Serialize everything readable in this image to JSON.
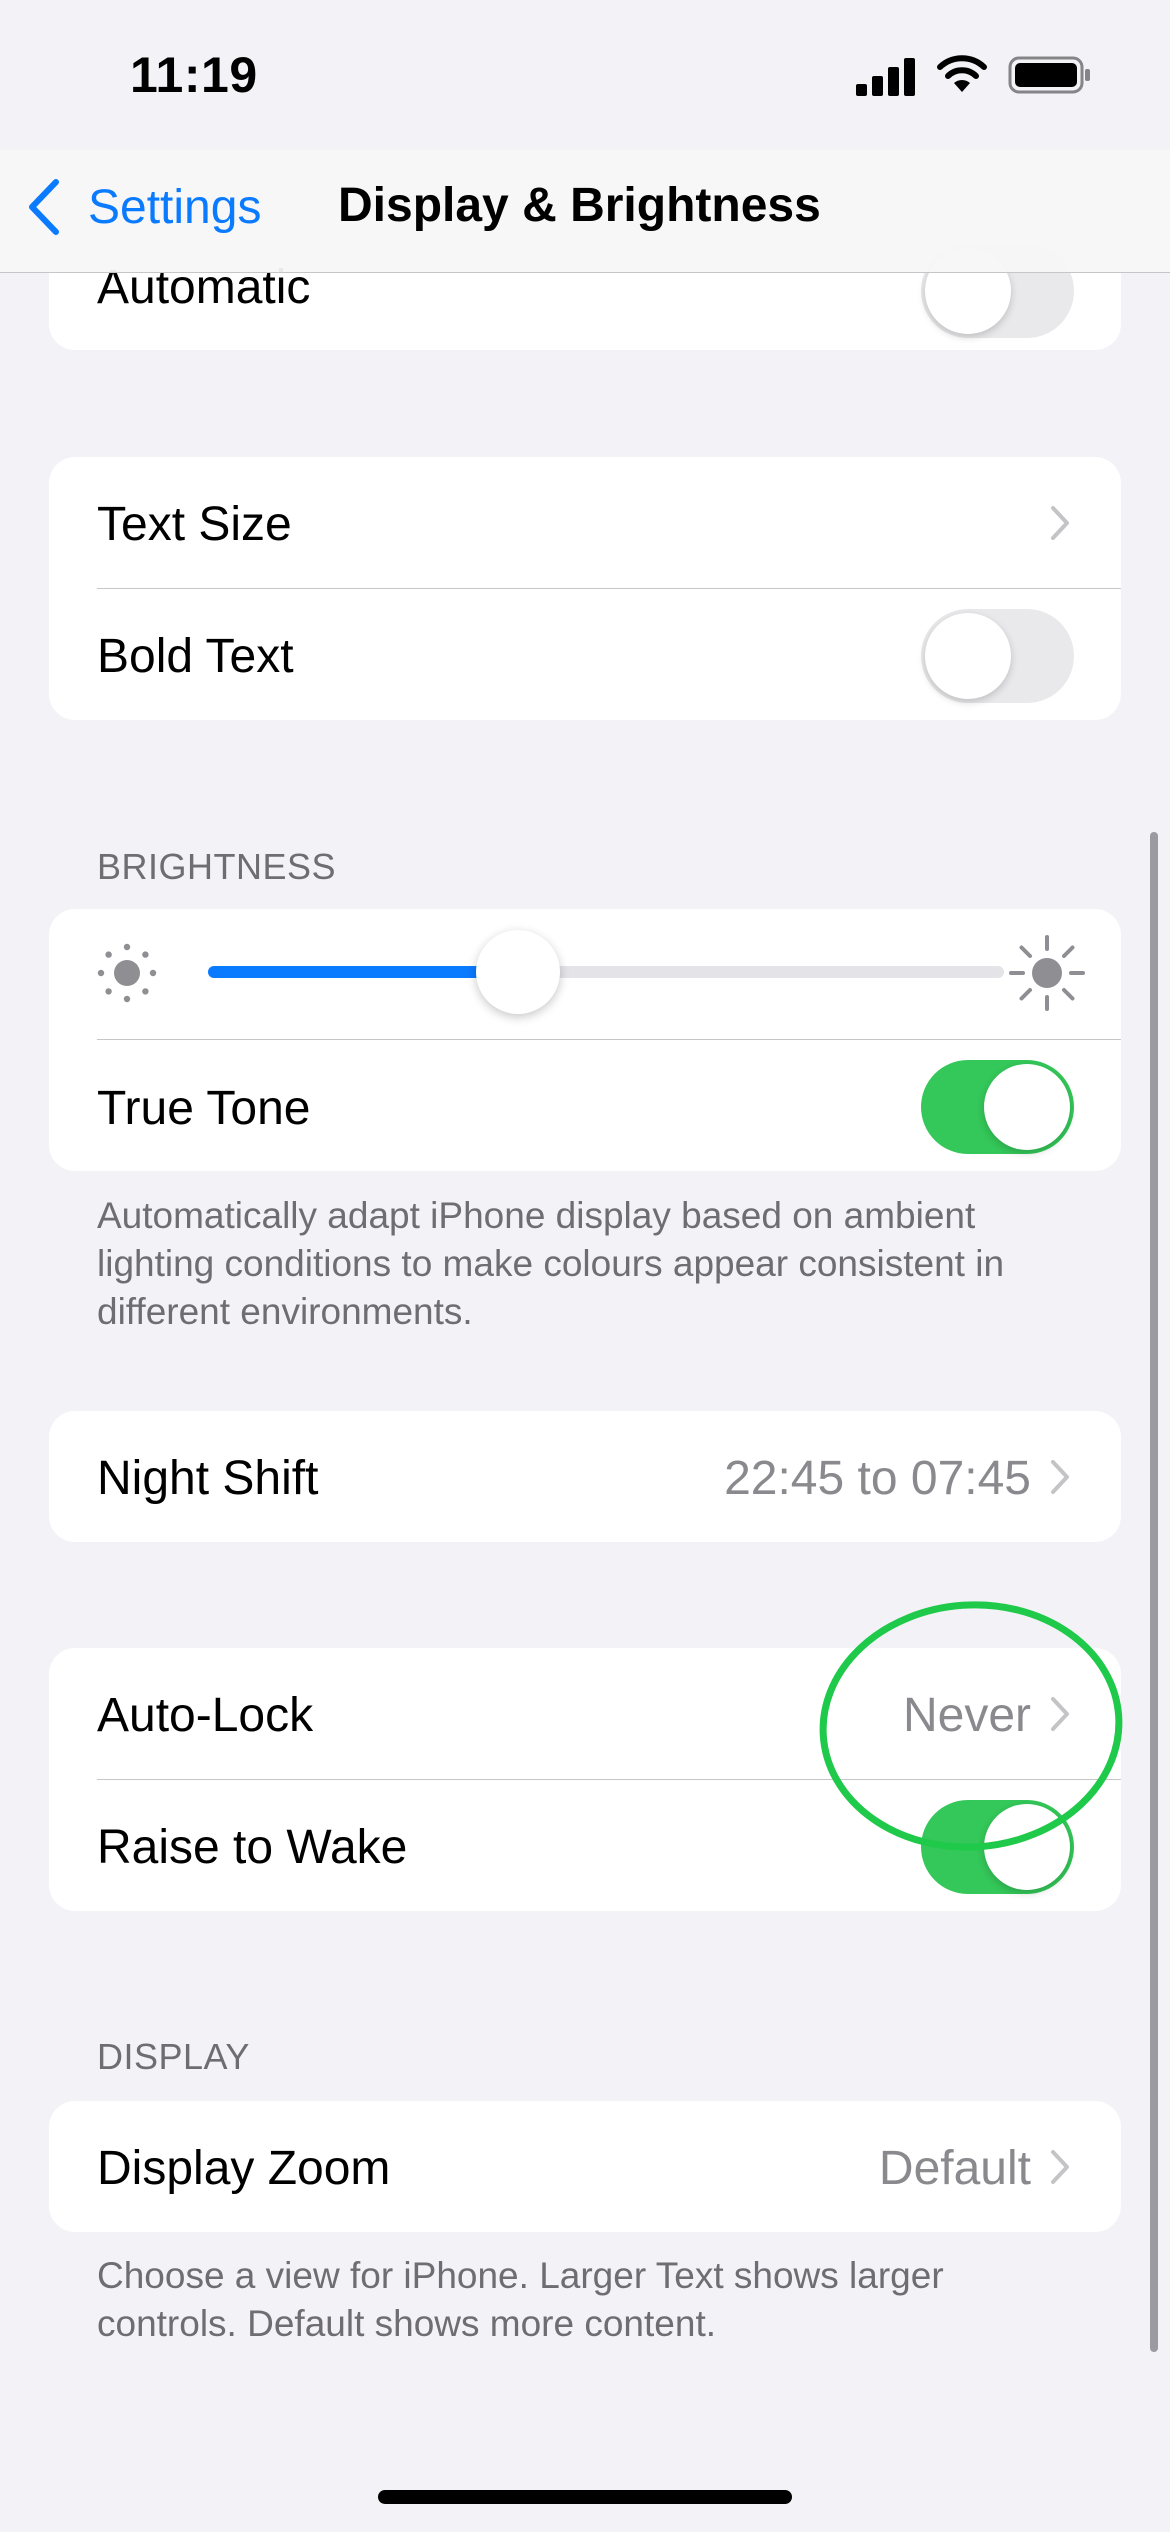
{
  "status_bar": {
    "time": "11:19",
    "signal_icon": "cellular-signal-icon",
    "wifi_icon": "wifi-icon",
    "battery_icon": "battery-icon"
  },
  "nav": {
    "back_label": "Settings",
    "title": "Display & Brightness",
    "back_icon": "chevron-left-icon"
  },
  "appearance": {
    "automatic_label": "Automatic",
    "automatic_on": false
  },
  "text": {
    "text_size_label": "Text Size",
    "bold_text_label": "Bold Text",
    "bold_text_on": false
  },
  "brightness": {
    "header": "BRIGHTNESS",
    "level": 0.39,
    "true_tone_label": "True Tone",
    "true_tone_on": true,
    "footer": "Automatically adapt iPhone display based on ambient lighting conditions to make colours appear consistent in different environments."
  },
  "night_shift": {
    "label": "Night Shift",
    "value": "22:45 to 07:45"
  },
  "lock": {
    "auto_lock_label": "Auto-Lock",
    "auto_lock_value": "Never",
    "raise_to_wake_label": "Raise to Wake",
    "raise_to_wake_on": true
  },
  "display": {
    "header": "DISPLAY",
    "zoom_label": "Display Zoom",
    "zoom_value": "Default",
    "footer": "Choose a view for iPhone. Larger Text shows larger controls. Default shows more content."
  },
  "colors": {
    "accent": "#0a7aff",
    "toggle_on": "#34c759",
    "annotation": "#1fc94a"
  }
}
